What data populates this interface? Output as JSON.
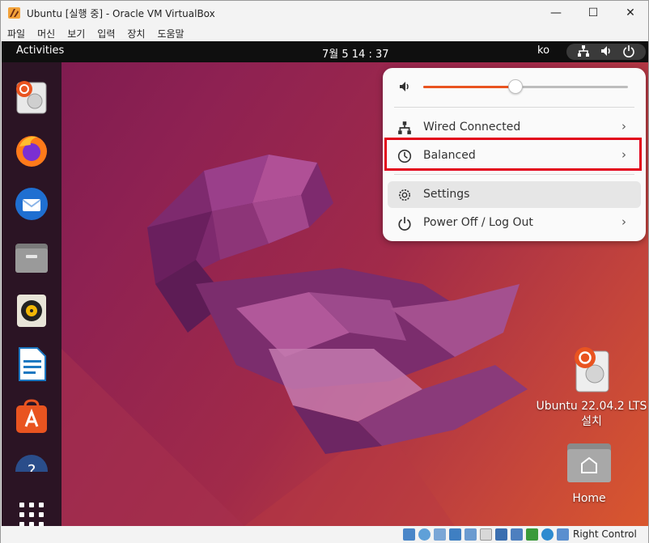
{
  "window": {
    "title": "Ubuntu [실행 중] - Oracle VM VirtualBox",
    "controls": {
      "minimize": "—",
      "maximize": "☐",
      "close": "✕"
    }
  },
  "menubar": {
    "items": [
      "파일",
      "머신",
      "보기",
      "입력",
      "장치",
      "도움말"
    ]
  },
  "topbar": {
    "activities": "Activities",
    "clock": "7월 5  14 : 37",
    "lang": "ko"
  },
  "dock": {
    "icons": [
      "installer-icon",
      "firefox-icon",
      "thunderbird-icon",
      "files-icon",
      "rhythmbox-icon",
      "writer-icon",
      "app-center-icon",
      "help-icon",
      "show-apps-icon"
    ]
  },
  "quick_settings": {
    "volume_level": 0.45,
    "items": [
      {
        "label": "Wired Connected",
        "icon": "network-wired-icon",
        "chevron": "›"
      },
      {
        "label": "Balanced",
        "icon": "power-profile-icon",
        "chevron": "›"
      },
      {
        "label": "Settings",
        "icon": "settings-gear-icon"
      },
      {
        "label": "Power Off / Log Out",
        "icon": "power-icon",
        "chevron": "›"
      }
    ]
  },
  "desktop": {
    "installer_label_1": "Ubuntu 22.04.2 LTS",
    "installer_label_2": "설치",
    "home_label": "Home"
  },
  "statusbar": {
    "right_control": "Right Control"
  },
  "colors": {
    "accent": "#e95420",
    "highlight_box": "#e2001a",
    "topbar": "#0f0f0f",
    "dock": "#2b1424"
  }
}
